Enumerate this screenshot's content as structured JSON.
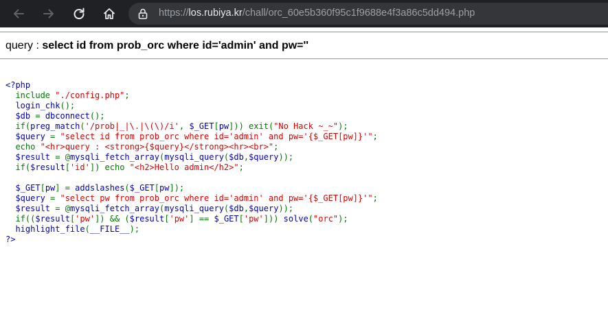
{
  "browser": {
    "url_scheme": "https://",
    "url_host": "los.rubiya.kr",
    "url_path": "/chall/orc_60e5b360f95c1f9688e4f3a86c5dd494.php",
    "icons": [
      "back-arrow-icon",
      "forward-arrow-icon",
      "reload-icon",
      "home-icon",
      "lock-icon"
    ]
  },
  "page": {
    "query_prefix": "query : ",
    "query_text": "select id from prob_orc where id='admin' and pw=''"
  },
  "source_lines": [
    [
      {
        "t": "<?php",
        "c": "def"
      }
    ],
    [
      {
        "t": "  include ",
        "c": "kw"
      },
      {
        "t": "\"./config.php\"",
        "c": "str"
      },
      {
        "t": ";",
        "c": "kw"
      }
    ],
    [
      {
        "t": "  login_chk",
        "c": "def"
      },
      {
        "t": "();",
        "c": "kw"
      }
    ],
    [
      {
        "t": "  $db ",
        "c": "def"
      },
      {
        "t": "= ",
        "c": "kw"
      },
      {
        "t": "dbconnect",
        "c": "def"
      },
      {
        "t": "();",
        "c": "kw"
      }
    ],
    [
      {
        "t": "  if(",
        "c": "kw"
      },
      {
        "t": "preg_match",
        "c": "def"
      },
      {
        "t": "(",
        "c": "kw"
      },
      {
        "t": "'/prob|_|\\.|\\(\\)/i'",
        "c": "str"
      },
      {
        "t": ", ",
        "c": "kw"
      },
      {
        "t": "$_GET",
        "c": "def"
      },
      {
        "t": "[",
        "c": "kw"
      },
      {
        "t": "pw",
        "c": "def"
      },
      {
        "t": "])) exit(",
        "c": "kw"
      },
      {
        "t": "\"No Hack ~_~\"",
        "c": "str"
      },
      {
        "t": ");",
        "c": "kw"
      }
    ],
    [
      {
        "t": "  $query ",
        "c": "def"
      },
      {
        "t": "= ",
        "c": "kw"
      },
      {
        "t": "\"select id from prob_orc where id='admin' and pw='{$_GET[pw]}'\"",
        "c": "str"
      },
      {
        "t": ";",
        "c": "kw"
      }
    ],
    [
      {
        "t": "  echo ",
        "c": "kw"
      },
      {
        "t": "\"<hr>query : <strong>{$query}</strong><hr><br>\"",
        "c": "str"
      },
      {
        "t": ";",
        "c": "kw"
      }
    ],
    [
      {
        "t": "  $result ",
        "c": "def"
      },
      {
        "t": "= @",
        "c": "kw"
      },
      {
        "t": "mysqli_fetch_array",
        "c": "def"
      },
      {
        "t": "(",
        "c": "kw"
      },
      {
        "t": "mysqli_query",
        "c": "def"
      },
      {
        "t": "(",
        "c": "kw"
      },
      {
        "t": "$db",
        "c": "def"
      },
      {
        "t": ",",
        "c": "kw"
      },
      {
        "t": "$query",
        "c": "def"
      },
      {
        "t": "));",
        "c": "kw"
      }
    ],
    [
      {
        "t": "  if(",
        "c": "kw"
      },
      {
        "t": "$result",
        "c": "def"
      },
      {
        "t": "[",
        "c": "kw"
      },
      {
        "t": "'id'",
        "c": "str"
      },
      {
        "t": "]) echo ",
        "c": "kw"
      },
      {
        "t": "\"<h2>Hello admin</h2>\"",
        "c": "str"
      },
      {
        "t": ";",
        "c": "kw"
      }
    ],
    [
      {
        "t": "",
        "c": "kw"
      }
    ],
    [
      {
        "t": "  $_GET",
        "c": "def"
      },
      {
        "t": "[",
        "c": "kw"
      },
      {
        "t": "pw",
        "c": "def"
      },
      {
        "t": "] = ",
        "c": "kw"
      },
      {
        "t": "addslashes",
        "c": "def"
      },
      {
        "t": "(",
        "c": "kw"
      },
      {
        "t": "$_GET",
        "c": "def"
      },
      {
        "t": "[",
        "c": "kw"
      },
      {
        "t": "pw",
        "c": "def"
      },
      {
        "t": "]);",
        "c": "kw"
      }
    ],
    [
      {
        "t": "  $query ",
        "c": "def"
      },
      {
        "t": "= ",
        "c": "kw"
      },
      {
        "t": "\"select pw from prob_orc where id='admin' and pw='{$_GET[pw]}'\"",
        "c": "str"
      },
      {
        "t": ";",
        "c": "kw"
      }
    ],
    [
      {
        "t": "  $result ",
        "c": "def"
      },
      {
        "t": "= @",
        "c": "kw"
      },
      {
        "t": "mysqli_fetch_array",
        "c": "def"
      },
      {
        "t": "(",
        "c": "kw"
      },
      {
        "t": "mysqli_query",
        "c": "def"
      },
      {
        "t": "(",
        "c": "kw"
      },
      {
        "t": "$db",
        "c": "def"
      },
      {
        "t": ",",
        "c": "kw"
      },
      {
        "t": "$query",
        "c": "def"
      },
      {
        "t": "));",
        "c": "kw"
      }
    ],
    [
      {
        "t": "  if((",
        "c": "kw"
      },
      {
        "t": "$result",
        "c": "def"
      },
      {
        "t": "[",
        "c": "kw"
      },
      {
        "t": "'pw'",
        "c": "str"
      },
      {
        "t": "]) && (",
        "c": "kw"
      },
      {
        "t": "$result",
        "c": "def"
      },
      {
        "t": "[",
        "c": "kw"
      },
      {
        "t": "'pw'",
        "c": "str"
      },
      {
        "t": "] == ",
        "c": "kw"
      },
      {
        "t": "$_GET",
        "c": "def"
      },
      {
        "t": "[",
        "c": "kw"
      },
      {
        "t": "'pw'",
        "c": "str"
      },
      {
        "t": "])) ",
        "c": "kw"
      },
      {
        "t": "solve",
        "c": "def"
      },
      {
        "t": "(",
        "c": "kw"
      },
      {
        "t": "\"orc\"",
        "c": "str"
      },
      {
        "t": ");",
        "c": "kw"
      }
    ],
    [
      {
        "t": "  highlight_file",
        "c": "def"
      },
      {
        "t": "(",
        "c": "kw"
      },
      {
        "t": "__FILE__",
        "c": "def"
      },
      {
        "t": ");",
        "c": "kw"
      }
    ],
    [
      {
        "t": "?>",
        "c": "def"
      }
    ]
  ]
}
